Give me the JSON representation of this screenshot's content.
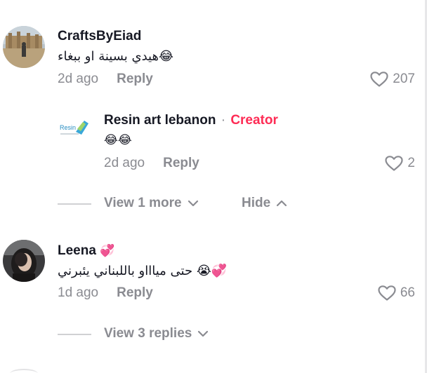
{
  "comments": [
    {
      "username": "CraftsByEiad",
      "text": "😂هيدي بسينة او ببغاء",
      "time": "2d ago",
      "reply_label": "Reply",
      "likes": "207",
      "avatar": "landscape-photo-avatar"
    },
    {
      "username": "Resin art lebanon",
      "creator_label": "Creator",
      "separator": "·",
      "text": "😂😂",
      "time": "2d ago",
      "reply_label": "Reply",
      "likes": "2",
      "avatar": "resin-logo-avatar"
    },
    {
      "username": "Leena",
      "username_emoji": "💞",
      "text": "💞😭 حتى مياااو باللبناني يئبرني",
      "time": "1d ago",
      "reply_label": "Reply",
      "likes": "66",
      "avatar": "portrait-photo-avatar"
    }
  ],
  "thread1": {
    "view_more_label": "View 1 more",
    "hide_label": "Hide"
  },
  "thread2": {
    "view_replies_label": "View 3 replies"
  },
  "colors": {
    "text": "#161823",
    "muted": "#8a8b91",
    "creator": "#fe2c55"
  },
  "icons": [
    "heart-icon",
    "chevron-down-icon",
    "chevron-up-icon"
  ]
}
